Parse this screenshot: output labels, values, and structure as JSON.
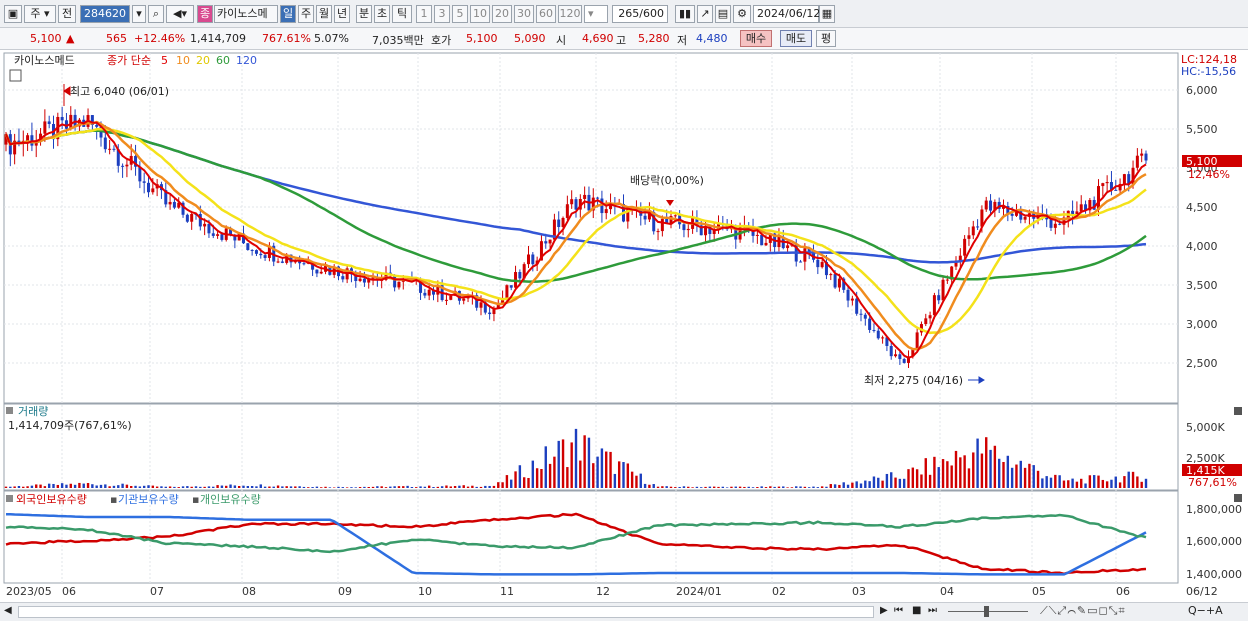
{
  "toolbar": {
    "market": "주",
    "prev": "전",
    "code": "284620",
    "stock_badge": "종",
    "stock_name": "카이노스메",
    "periods": [
      "일",
      "주",
      "월",
      "년",
      "분",
      "초",
      "틱"
    ],
    "intervals": [
      "1",
      "3",
      "5",
      "10",
      "20",
      "30",
      "60",
      "120"
    ],
    "count": "265/600",
    "date": "2024/06/12"
  },
  "price_bar": {
    "price": "5,100",
    "up_arrow": "▲",
    "change": "565",
    "change_pct": "+12.46%",
    "volume": "1,414,709",
    "vol_ratio": "767.61%",
    "turnover": "5.07%",
    "amount": "7,035백만",
    "ask_label": "호가",
    "ask": "5,100",
    "bid": "5,090",
    "open_label": "시",
    "open": "4,690",
    "high_label": "고",
    "high": "5,280",
    "low_label": "저",
    "low": "4,480",
    "buy": "매수",
    "sell": "매도",
    "avg": "평"
  },
  "price_panel": {
    "name": "카이노스메드",
    "ma_label": "종가 단순",
    "ma_periods": [
      "5",
      "10",
      "20",
      "60",
      "120"
    ],
    "lc": "LC:124,18",
    "hc": "HC:-15,56",
    "price_axis": [
      "6,000",
      "5,500",
      "5,000",
      "4,500",
      "4,000",
      "3,500",
      "3,000",
      "2,500"
    ],
    "current_price": "5,100",
    "current_pct": "12,46%",
    "annot_high": "최고 6,040 (06/01)",
    "annot_low": "최저 2,275 (04/16)",
    "annot_div": "배당락(0,00%)"
  },
  "volume_panel": {
    "label": "거래량",
    "value": "1,414,709주(767,61%)",
    "axis": [
      "5,000K",
      "2,500K"
    ],
    "current": "1,415K",
    "current_pct": "767,61%"
  },
  "holding_panel": {
    "legend": [
      "외국인보유수량",
      "기관보유수량",
      "개인보유수량"
    ],
    "axis": [
      "1,800,000",
      "1,600,000",
      "1,400,000"
    ]
  },
  "x_axis": [
    "2023/05",
    "06",
    "07",
    "08",
    "09",
    "10",
    "11",
    "12",
    "2024/01",
    "02",
    "03",
    "04",
    "05",
    "06",
    "06/12"
  ],
  "colors": {
    "up": "#d00000",
    "down": "#1c3fbf",
    "ma5": "#e00000",
    "ma10": "#f08c1e",
    "ma20": "#f4e21a",
    "ma60": "#2e9b3a",
    "ma120": "#3356d6",
    "foreign": "#d00000",
    "inst": "#2e6fe0",
    "indiv": "#3a9a6a"
  },
  "chart_data": [
    {
      "type": "line",
      "title": "카이노스메드",
      "x": [
        "2023/05",
        "06",
        "07",
        "08",
        "09",
        "10",
        "11",
        "12",
        "2024/01",
        "02",
        "03",
        "04",
        "05",
        "06",
        "06/12"
      ],
      "series": [
        {
          "name": "종가",
          "values": [
            5300,
            5600,
            4500,
            4000,
            3700,
            3500,
            3200,
            4600,
            4300,
            4200,
            3800,
            2450,
            4500,
            4300,
            5100
          ]
        }
      ],
      "ylim": [
        2200,
        6300
      ]
    },
    {
      "type": "bar",
      "title": "거래량",
      "values": [
        150,
        500,
        120,
        350,
        100,
        180,
        250,
        5200,
        150,
        120,
        150,
        1400,
        4500,
        800,
        1415
      ]
    },
    {
      "type": "line",
      "title": "보유수량",
      "series": [
        {
          "name": "외국인보유수량",
          "values": [
            1620,
            1640,
            1670,
            1760,
            1760,
            1740,
            1790,
            1830,
            1620,
            1590,
            1580,
            1610,
            1440,
            1410,
            1440
          ]
        },
        {
          "name": "기관보유수량",
          "values": [
            1830,
            1810,
            1810,
            1790,
            1790,
            1410,
            1400,
            1400,
            1410,
            1410,
            1410,
            1410,
            1400,
            1400,
            1700
          ]
        },
        {
          "name": "개인보유수량",
          "values": [
            1740,
            1720,
            1620,
            1600,
            1560,
            1650,
            1600,
            1590,
            1750,
            1760,
            1770,
            1740,
            1800,
            1820,
            1660
          ]
        }
      ],
      "ylim": [
        1360,
        1880
      ]
    }
  ]
}
